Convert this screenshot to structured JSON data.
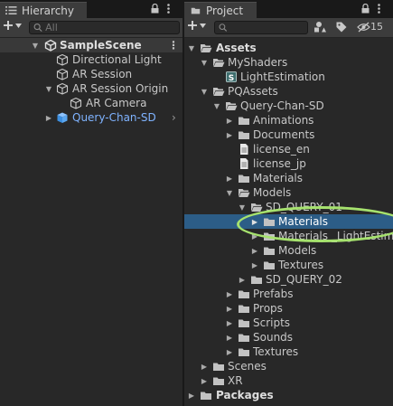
{
  "hierarchy": {
    "tab_label": "Hierarchy",
    "search_placeholder": "All",
    "scene": "SampleScene",
    "items": [
      {
        "label": "Directional Light"
      },
      {
        "label": "AR Session"
      },
      {
        "label": "AR Session Origin"
      },
      {
        "label": "AR Camera"
      },
      {
        "label": "Query-Chan-SD"
      }
    ]
  },
  "project": {
    "tab_label": "Project",
    "hidden_count": "15",
    "tree": [
      {
        "label": "Assets"
      },
      {
        "label": "MyShaders"
      },
      {
        "label": "LightEstimation"
      },
      {
        "label": "PQAssets"
      },
      {
        "label": "Query-Chan-SD"
      },
      {
        "label": "Animations"
      },
      {
        "label": "Documents"
      },
      {
        "label": "license_en"
      },
      {
        "label": "license_jp"
      },
      {
        "label": "Materials"
      },
      {
        "label": "Models"
      },
      {
        "label": "SD_QUERY_01"
      },
      {
        "label": "Materials"
      },
      {
        "label": "Materials _LightEstima"
      },
      {
        "label": "Models"
      },
      {
        "label": "Textures"
      },
      {
        "label": "SD_QUERY_02"
      },
      {
        "label": "Prefabs"
      },
      {
        "label": "Props"
      },
      {
        "label": "Scripts"
      },
      {
        "label": "Sounds"
      },
      {
        "label": "Textures"
      },
      {
        "label": "Scenes"
      },
      {
        "label": "XR"
      },
      {
        "label": "Packages"
      }
    ]
  },
  "colors": {
    "selection": "#2c5d87",
    "prefab_text": "#7fb3ff",
    "annotation": "#a6e26e"
  }
}
